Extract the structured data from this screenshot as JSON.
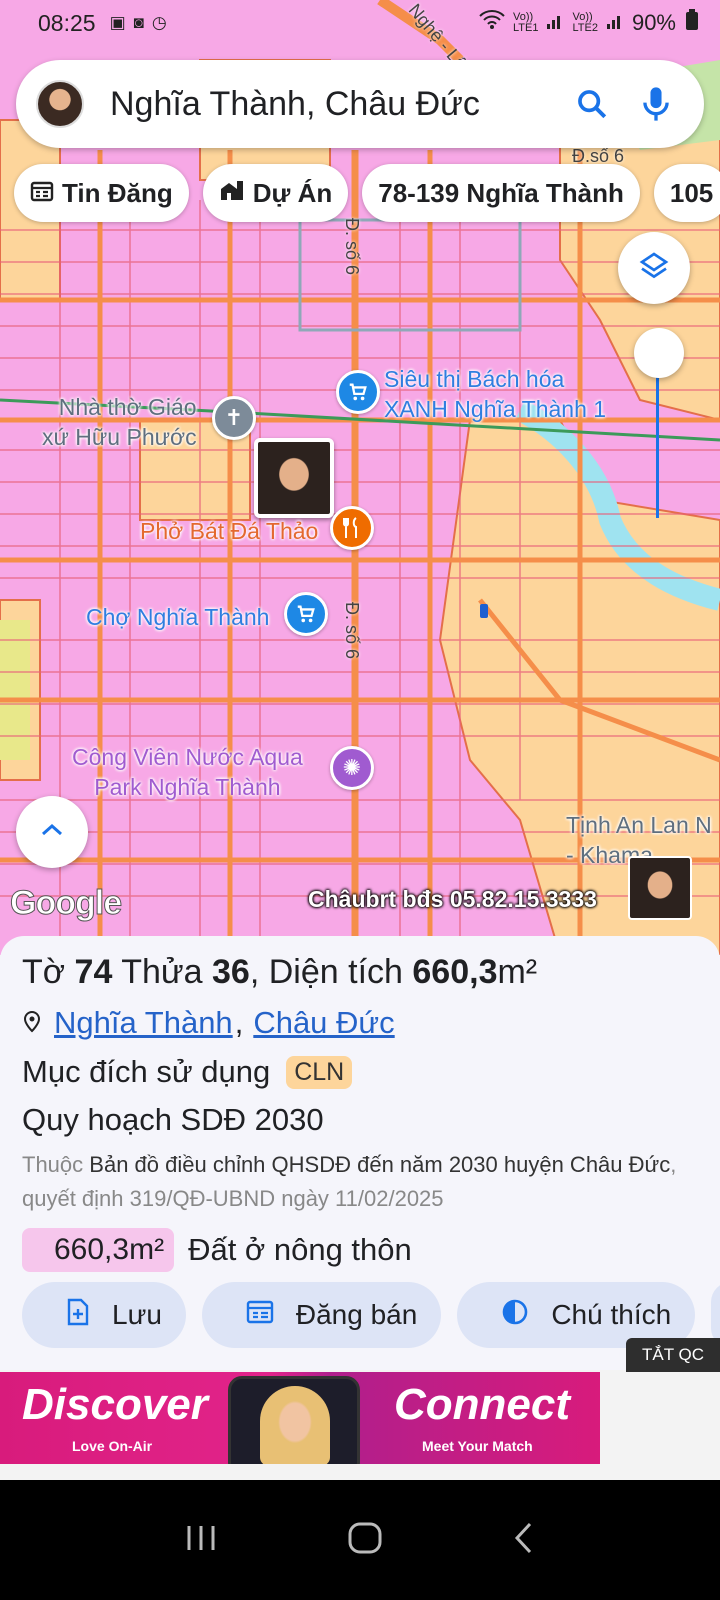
{
  "status_bar": {
    "time": "08:25",
    "net1": "Vo))\nLTE1",
    "net2": "Vo))\nLTE2",
    "battery": "90%"
  },
  "search": {
    "query": "Nghĩa Thành, Châu Đức",
    "search_icon": "search-icon",
    "mic_icon": "mic-icon"
  },
  "chips": [
    {
      "label": "Tin Đăng",
      "icon": "calendar-icon"
    },
    {
      "label": "Dự Án",
      "icon": "buildings-icon"
    },
    {
      "label": "78-139 Nghĩa Thành",
      "icon": ""
    },
    {
      "label": "105",
      "icon": ""
    }
  ],
  "map": {
    "road_labels": [
      "Đ. số 6",
      "Đ. số 6",
      "Nghệ - Lân",
      "Đ.số 6"
    ],
    "places": {
      "sieu_thi": "Siêu thị Bách hóa\nXANH Nghĩa Thành 1",
      "nha_tho": "Nhà thờ Giáo\nxứ Hữu Phước",
      "pho": "Phở Bát Đá Thảo",
      "cho": "Chợ Nghĩa Thành",
      "cong_vien": "Công Viên Nước Aqua\nPark Nghĩa Thành",
      "tinh_an": "Tịnh An Lan N\n- Khama"
    },
    "google_logo": "Google",
    "watermark": "Châubrt bđs 05.82.15.3333"
  },
  "parcel": {
    "to_label": "Tờ",
    "to_value": "74",
    "thua_label": "Thửa",
    "thua_value": "36",
    "area_label": "Diện tích",
    "area_value": "660,3",
    "area_unit": "m²",
    "ward": "Nghĩa Thành",
    "district": "Châu Đức",
    "purpose_label": "Mục đích sử dụng",
    "purpose_code": "CLN",
    "plan_title": "Quy hoạch SDĐ 2030",
    "belongs_label": "Thuộc",
    "plan_map": "Bản đồ điều chỉnh QHSDĐ đến năm 2030 huyện Châu Đức",
    "decision": ", quyết định 319/QĐ-UBND ngày 11/02/2025",
    "zone_area": "660,3m²",
    "zone_type": "Đất ở nông thôn"
  },
  "actions": [
    {
      "label": "Lưu",
      "icon": "save-doc-icon"
    },
    {
      "label": "Đăng bán",
      "icon": "post-icon"
    },
    {
      "label": "Chú thích",
      "icon": "legend-icon"
    }
  ],
  "ad": {
    "close_label": "TẮT QC",
    "left_title": "Discover",
    "left_sub": "Love On-Air",
    "right_title": "Connect",
    "right_sub": "Meet Your Match"
  },
  "colors": {
    "map_residential": "#f7a8e6",
    "map_agri": "#fdd59b",
    "road": "#f58e4a",
    "accent_blue": "#1a73e8",
    "link": "#2563c9"
  }
}
